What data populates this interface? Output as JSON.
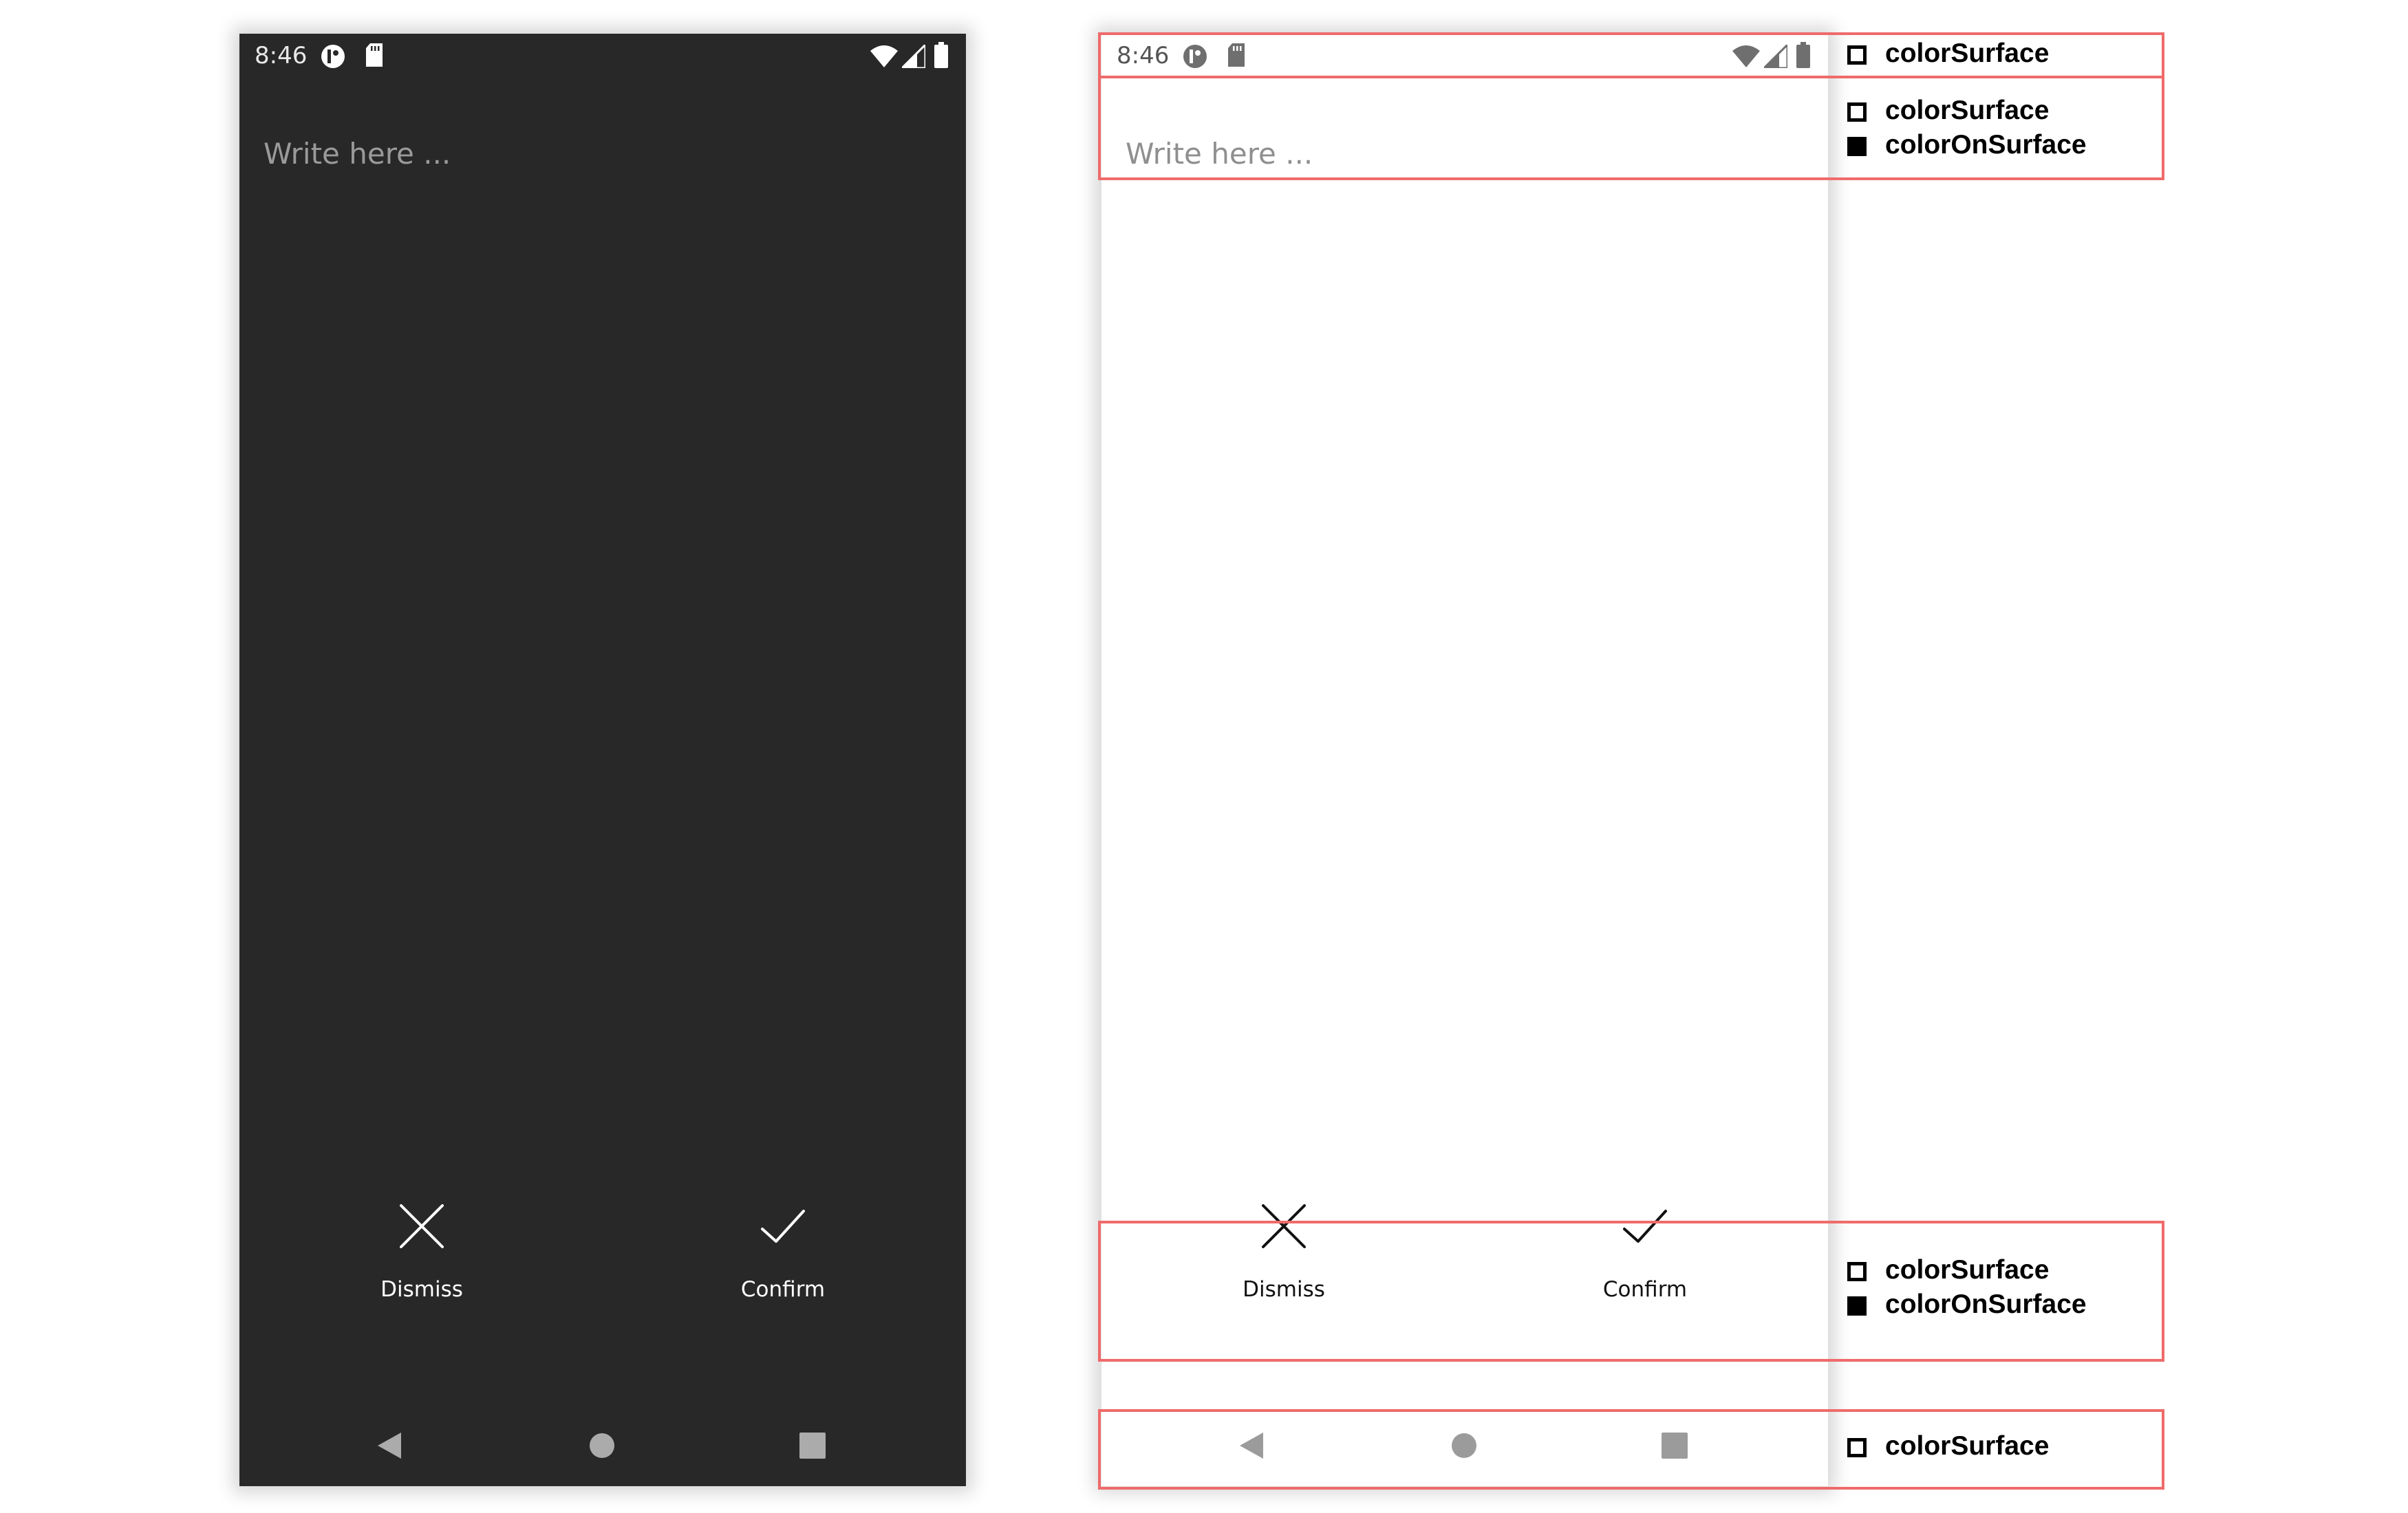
{
  "phones": {
    "dark": {
      "status_time": "8:46",
      "input_placeholder": "Write here ...",
      "dismiss_label": "Dismiss",
      "confirm_label": "Confirm",
      "surface_color": "#282828",
      "on_surface_color": "#ffffff"
    },
    "light": {
      "status_time": "8:46",
      "input_placeholder": "Write here ...",
      "dismiss_label": "Dismiss",
      "confirm_label": "Confirm",
      "surface_color": "#ffffff",
      "on_surface_color": "#111111"
    }
  },
  "icons": {
    "status": [
      "app-icon",
      "sd-card-icon",
      "wifi-icon",
      "cell-signal-icon",
      "battery-icon"
    ],
    "actions": [
      "close-icon",
      "check-icon"
    ],
    "navigation": [
      "back-icon",
      "home-icon",
      "recents-icon"
    ]
  },
  "annotations": {
    "highlight_color": "#ef6b6b",
    "status_bar": [
      {
        "label": "colorSurface",
        "swatch": "outline"
      }
    ],
    "text_field": [
      {
        "label": "colorSurface",
        "swatch": "outline"
      },
      {
        "label": "colorOnSurface",
        "swatch": "filled"
      }
    ],
    "button_bar": [
      {
        "label": "colorSurface",
        "swatch": "outline"
      },
      {
        "label": "colorOnSurface",
        "swatch": "filled"
      }
    ],
    "nav_bar": [
      {
        "label": "colorSurface",
        "swatch": "outline"
      }
    ]
  }
}
